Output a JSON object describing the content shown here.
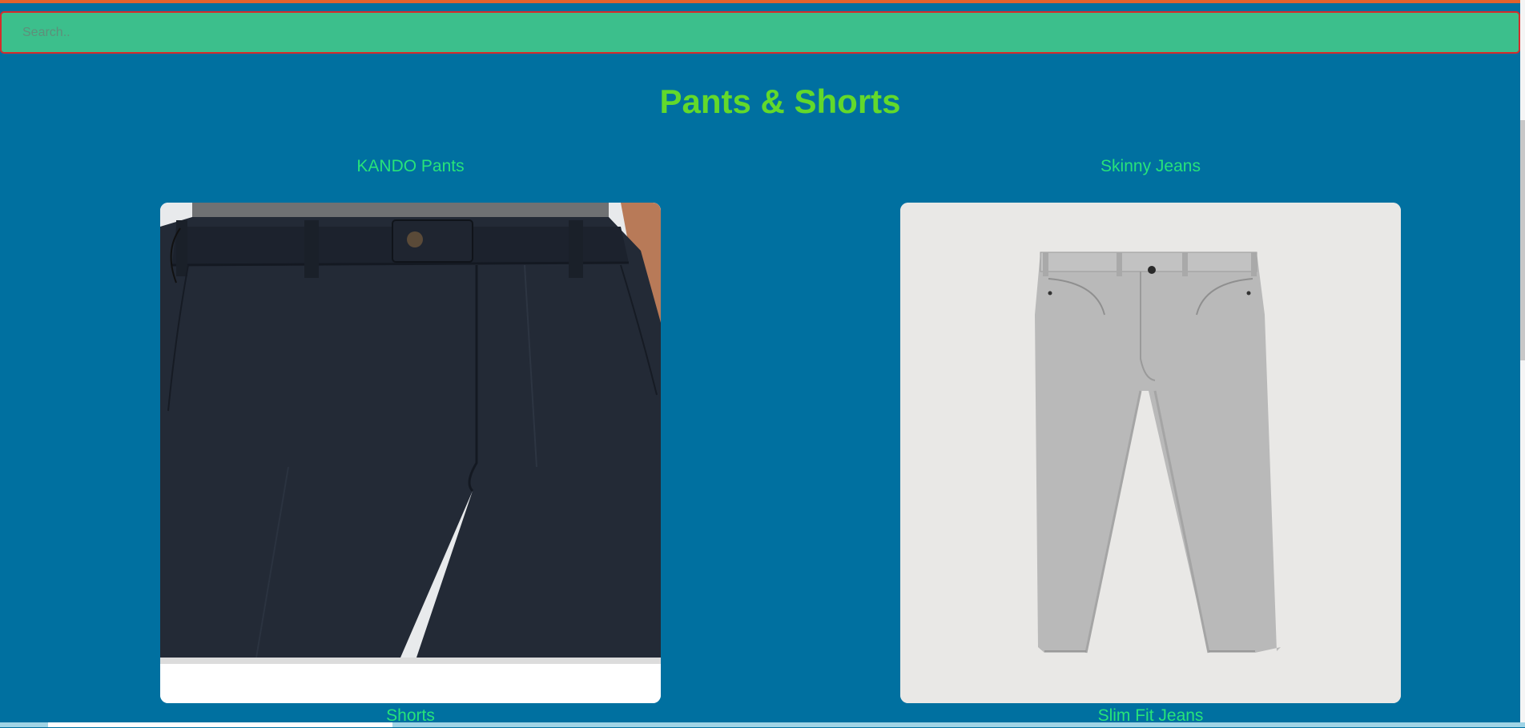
{
  "search": {
    "placeholder": "Search..",
    "value": ""
  },
  "page": {
    "title": "Pants & Shorts"
  },
  "products": [
    {
      "name": "KANDO Pants",
      "image_icon": "pants-image"
    },
    {
      "name": "Skinny Jeans",
      "image_icon": "jeans-image"
    },
    {
      "name": "Shorts"
    },
    {
      "name": "Slim Fit Jeans"
    }
  ],
  "colors": {
    "background": "#0070a0",
    "search_bg": "#3cbf8c",
    "search_border": "#d62b2b",
    "title": "#62d92b",
    "product_name": "#27e37a",
    "top_strip": "#e2622c"
  }
}
